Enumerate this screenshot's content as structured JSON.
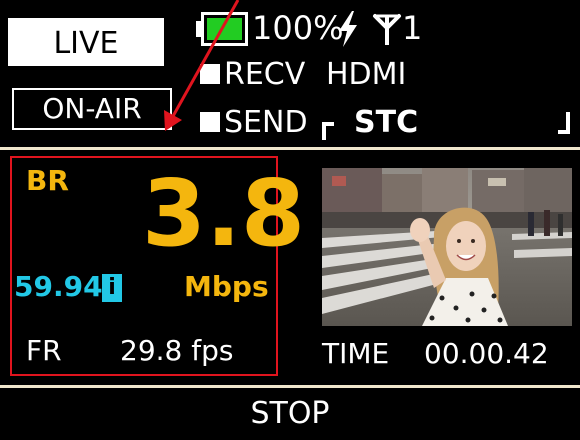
{
  "mode": {
    "live_label": "LIVE",
    "onair_label": "ON-AIR"
  },
  "status": {
    "battery_percent": "100%",
    "battery_level": 1.0,
    "battery_color": "#22cc22",
    "power_icon": "bolt-icon",
    "antenna_icon": "antenna-icon",
    "antenna_count": "1"
  },
  "indicators": {
    "recv_label": "RECV",
    "source_label": "HDMI",
    "send_label": "SEND",
    "stc_label": "STC"
  },
  "bitrate": {
    "label": "BR",
    "value": "3.8",
    "unit": "Mbps",
    "frame_rate_setting": "59.94",
    "info_badge": "i",
    "accent_color": "#f4b60e",
    "info_color": "#22c8e6"
  },
  "frame_rate": {
    "label": "FR",
    "value": "29.8 fps"
  },
  "time": {
    "label": "TIME",
    "value": "00.00.42"
  },
  "footer": {
    "stop_label": "STOP"
  },
  "annotation": {
    "color": "#e0141e"
  }
}
